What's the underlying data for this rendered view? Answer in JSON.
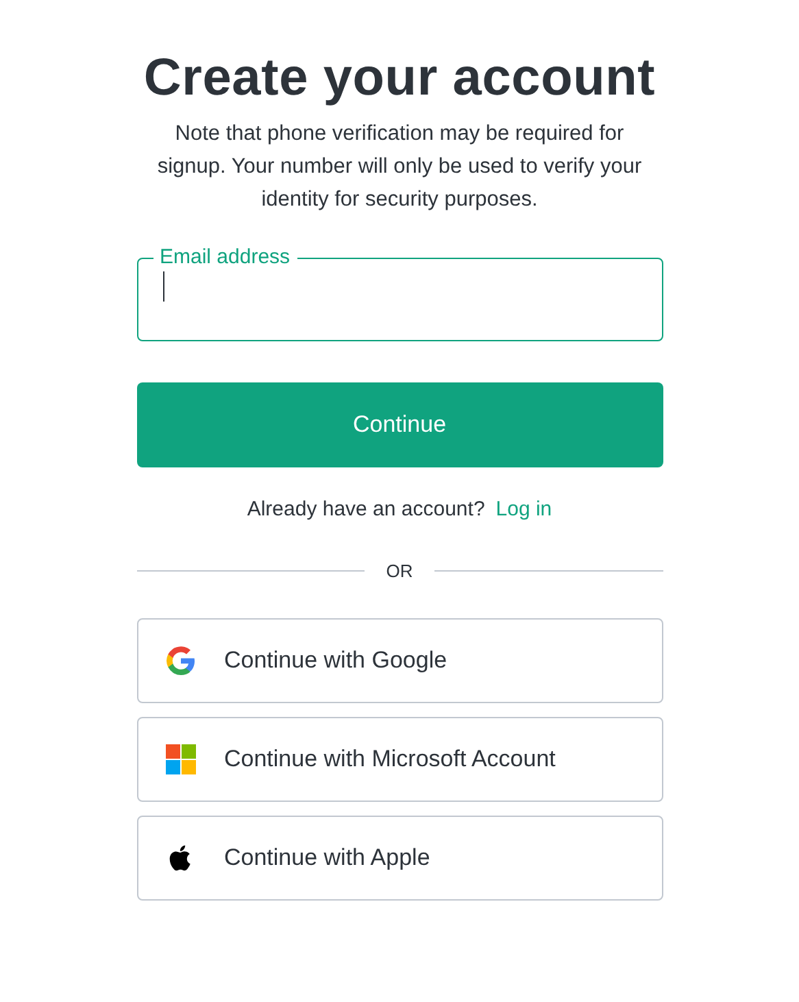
{
  "title": "Create your account",
  "note": "Note that phone verification may be required for signup. Your number will only be used to verify your identity for security purposes.",
  "email_field": {
    "label": "Email address",
    "focused": true
  },
  "continue_button": "Continue",
  "login_prompt": {
    "text": "Already have an account?",
    "link": "Log in"
  },
  "divider": "OR",
  "providers": [
    {
      "kind": "google",
      "label": "Continue with Google"
    },
    {
      "kind": "microsoft",
      "label": "Continue with Microsoft Account"
    },
    {
      "kind": "apple",
      "label": "Continue with Apple"
    }
  ]
}
